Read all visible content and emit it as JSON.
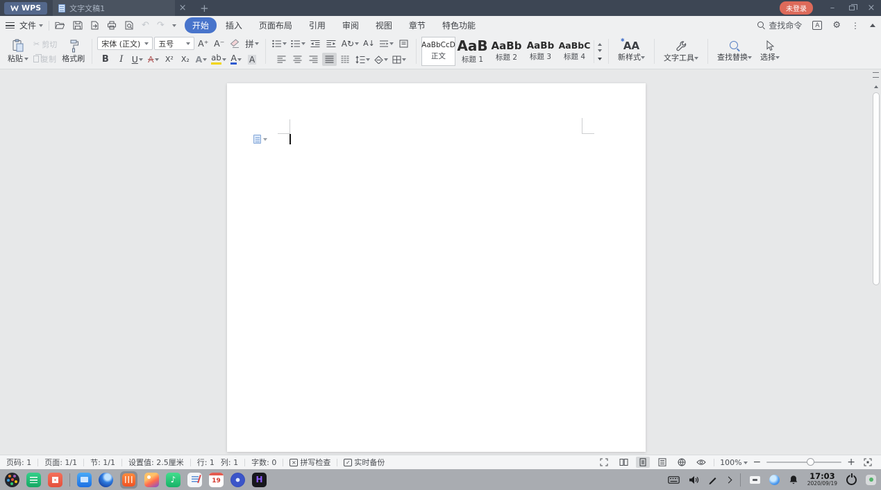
{
  "titlebar": {
    "app_name": "WPS",
    "tab_title": "文字文稿1",
    "login_badge": "未登录"
  },
  "menubar": {
    "file_label": "文件",
    "tabs": [
      {
        "label": "开始"
      },
      {
        "label": "插入"
      },
      {
        "label": "页面布局"
      },
      {
        "label": "引用"
      },
      {
        "label": "审阅"
      },
      {
        "label": "视图"
      },
      {
        "label": "章节"
      },
      {
        "label": "特色功能"
      }
    ],
    "search_label": "查找命令"
  },
  "ribbon": {
    "paste_label": "粘贴",
    "cut_label": "剪切",
    "copy_label": "复制",
    "format_painter_label": "格式刷",
    "font_name": "宋体 (正文)",
    "font_size": "五号",
    "increase_font": "A⁺",
    "decrease_font": "A⁻",
    "pinyin_char": "拼",
    "bold": "B",
    "italic": "I",
    "underline": "U",
    "strikethrough": "A",
    "superscript": "X²",
    "subscript": "X₂",
    "text_effect": "A",
    "highlight": "ab",
    "font_color": "A",
    "char_shading": "A",
    "sort_label": "A↓",
    "styles": [
      {
        "preview": "AaBbCcD",
        "label": "正文"
      },
      {
        "preview": "AaB",
        "label": "标题 1"
      },
      {
        "preview": "AaBb",
        "label": "标题 2"
      },
      {
        "preview": "AaBb",
        "label": "标题 3"
      },
      {
        "preview": "AaBbC",
        "label": "标题 4"
      }
    ],
    "new_style_label": "新样式",
    "new_style_icon_text": "AA",
    "text_tool_label": "文字工具",
    "find_replace_label": "查找替换",
    "select_label": "选择"
  },
  "statusbar": {
    "page_number": "页码: 1",
    "page_count": "页面: 1/1",
    "section": "节: 1/1",
    "margin_setting": "设置值: 2.5厘米",
    "line": "行: 1",
    "column": "列: 1",
    "word_count": "字数: 0",
    "spellcheck_label": "拼写检查",
    "backup_label": "实时备份",
    "zoom_level": "100%"
  },
  "taskbar": {
    "time": "17:03",
    "date": "2020/09/19",
    "calendar_day": "19"
  },
  "colors": {
    "accent_blue": "#4874cb",
    "titlebar_bg": "#3d4654",
    "login_badge_red": "#dd6a5a",
    "taskbar_bg": "#a9acb1"
  }
}
